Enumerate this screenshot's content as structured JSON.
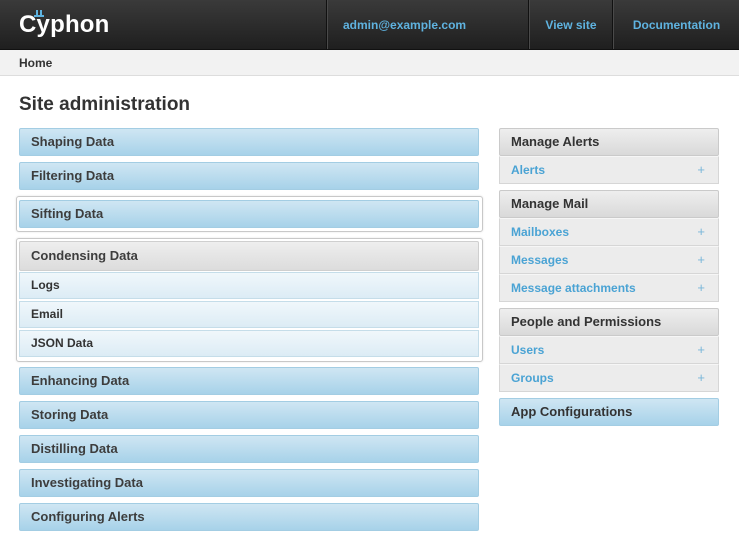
{
  "header": {
    "logo_text": "Cyphon",
    "user_email": "admin@example.com",
    "view_site": "View site",
    "documentation": "Documentation"
  },
  "breadcrumb": {
    "home": "Home"
  },
  "page_title": "Site administration",
  "left_modules": {
    "shaping": "Shaping Data",
    "filtering": "Filtering Data",
    "sifting": "Sifting Data",
    "condensing": {
      "title": "Condensing Data",
      "items": [
        "Logs",
        "Email",
        "JSON Data"
      ]
    },
    "enhancing": "Enhancing Data",
    "storing": "Storing Data",
    "distilling": "Distilling Data",
    "investigating": "Investigating Data",
    "configuring_alerts": "Configuring Alerts"
  },
  "right_modules": {
    "manage_alerts": {
      "title": "Manage Alerts",
      "items": [
        "Alerts"
      ]
    },
    "manage_mail": {
      "title": "Manage Mail",
      "items": [
        "Mailboxes",
        "Messages",
        "Message attachments"
      ]
    },
    "people": {
      "title": "People and Permissions",
      "items": [
        "Users",
        "Groups"
      ]
    },
    "app_config": "App Configurations",
    "add_symbol": "+"
  },
  "colors": {
    "header_bg": "#2a2a2a",
    "link_blue": "#4aa3d4",
    "module_blue": "#b9dcef"
  }
}
